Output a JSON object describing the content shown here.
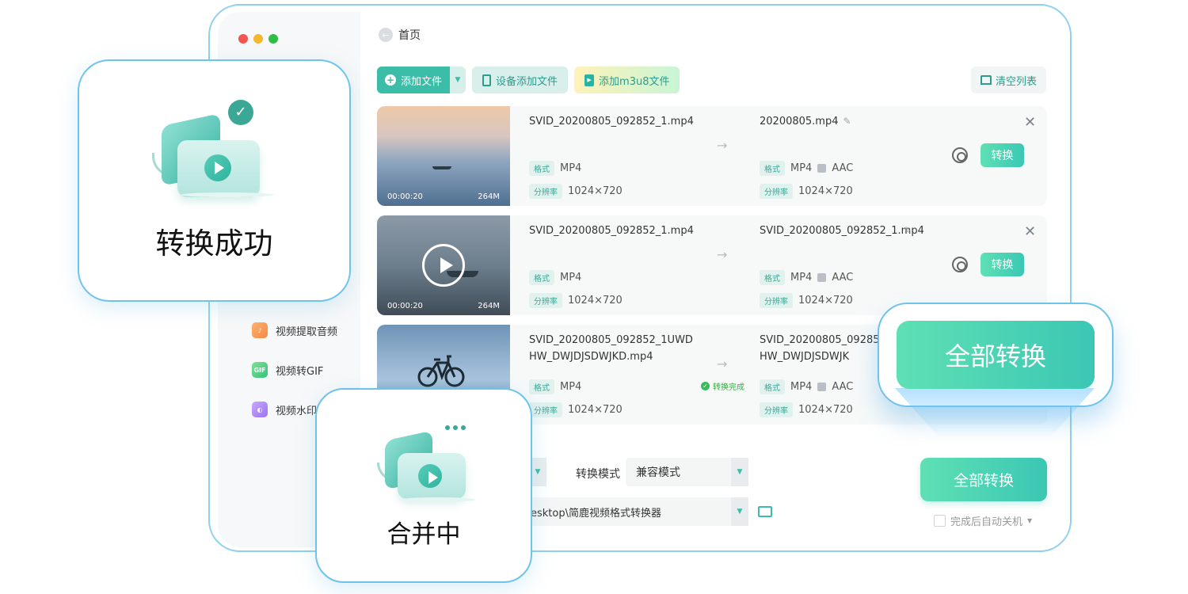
{
  "app": {
    "breadcrumb": "首页",
    "toolbar": {
      "add_file": "添加文件",
      "device_add_file": "设备添加文件",
      "add_m3u8": "添加m3u8文件",
      "clear_list": "清空列表"
    },
    "sidebar": {
      "items": [
        {
          "label": "视频提取音频",
          "icon": "audio-extract-icon"
        },
        {
          "label": "视频转GIF",
          "icon": "gif-icon",
          "icon_text": "GIF"
        },
        {
          "label": "视频水印",
          "icon": "watermark-icon"
        }
      ]
    },
    "tag_format": "格式",
    "tag_resolution": "分辨率",
    "arrow": "→",
    "convert_label": "转换",
    "rows": [
      {
        "duration": "00:00:20",
        "size": "264M",
        "src_name": "SVID_20200805_092852_1.mp4",
        "src_format": "MP4",
        "src_resolution": "1024×720",
        "dst_name": "20200805.mp4",
        "dst_format": "MP4",
        "dst_audio": "AAC",
        "dst_resolution": "1024×720"
      },
      {
        "duration": "00:00:20",
        "size": "264M",
        "src_name": "SVID_20200805_092852_1.mp4",
        "src_format": "MP4",
        "src_resolution": "1024×720",
        "dst_name": "SVID_20200805_092852_1.mp4",
        "dst_format": "MP4",
        "dst_audio": "AAC",
        "dst_resolution": "1024×720"
      },
      {
        "src_name": "SVID_20200805_092852_1UWDHW_DWJDJSDWJKD.mp4",
        "src_format": "MP4",
        "src_resolution": "1024×720",
        "status": "转换完成",
        "dst_name": "SVID_20200805_092852_1UWDHW_DWJDJSDWJK",
        "dst_format": "MP4",
        "dst_audio": "AAC",
        "dst_resolution": "1024×720"
      }
    ],
    "footer": {
      "mode_label": "转换模式",
      "mode_value": "兼容模式",
      "output_path": "esktop\\简鹿视频格式转换器",
      "convert_all": "全部转换",
      "auto_shutdown": "完成后自动关机"
    }
  },
  "overlays": {
    "success_label": "转换成功",
    "merging_label": "合并中",
    "convert_all_big": "全部转换"
  },
  "colors": {
    "accent": "#3bc7b4",
    "accent_light": "#5fe0b4",
    "card_border": "#6dc3ea",
    "tag_bg": "#e0f1ee",
    "success_green": "#3bb860"
  }
}
